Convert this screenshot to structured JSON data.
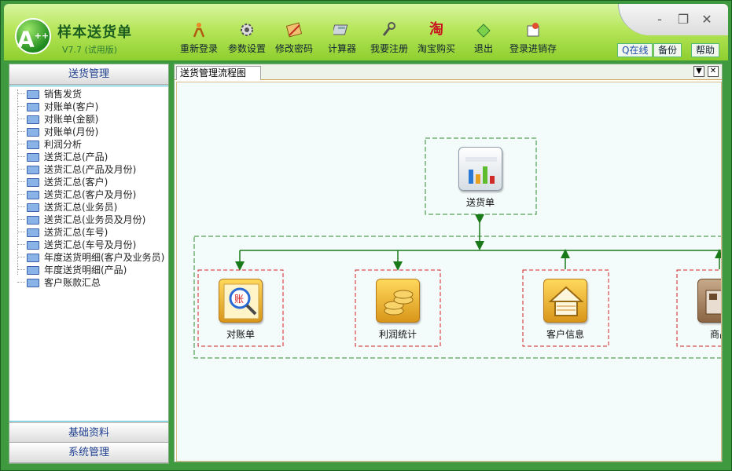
{
  "app": {
    "name": "样本送货单",
    "version": "V7.7 (试用版)",
    "logo_text": "A"
  },
  "window_controls": {
    "minimize": "-",
    "restore": "❐",
    "close": "✕"
  },
  "toolbar": {
    "items": [
      {
        "label": "重新登录",
        "icon": "relogin-icon"
      },
      {
        "label": "参数设置",
        "icon": "settings-gear-icon"
      },
      {
        "label": "修改密码",
        "icon": "password-icon"
      },
      {
        "label": "计算器",
        "icon": "calculator-icon"
      },
      {
        "label": "我要注册",
        "icon": "register-icon"
      },
      {
        "label": "淘宝购买",
        "icon": "taobao-icon"
      },
      {
        "label": "退出",
        "icon": "exit-icon"
      },
      {
        "label": "登录进销存",
        "icon": "inventory-login-icon"
      }
    ],
    "online": "Q在线",
    "backup": "备份",
    "help": "帮助"
  },
  "left_panel": {
    "section_title": "送货管理",
    "tree_items": [
      "销售发货",
      "对账单(客户)",
      "对账单(金额)",
      "对账单(月份)",
      "利润分析",
      "送货汇总(产品)",
      "送货汇总(产品及月份)",
      "送货汇总(客户)",
      "送货汇总(客户及月份)",
      "送货汇总(业务员)",
      "送货汇总(业务员及月份)",
      "送货汇总(车号)",
      "送货汇总(车号及月份)",
      "年度送货明细(客户及业务员)",
      "年度送货明细(产品)",
      "客户账款汇总"
    ],
    "bottom_sections": [
      "基础资料",
      "系统管理"
    ]
  },
  "tab": {
    "title": "送货管理流程图",
    "dropdown": "▼",
    "close": "✕"
  },
  "flowchart": {
    "top_node": {
      "label": "送货单",
      "icon": "delivery-note-chart-icon"
    },
    "nodes": [
      {
        "label": "对账单",
        "icon": "statement-magnifier-icon"
      },
      {
        "label": "利润统计",
        "icon": "coins-stack-icon"
      },
      {
        "label": "客户信息",
        "icon": "house-icon"
      },
      {
        "label": "商品",
        "icon": "goods-icon"
      }
    ],
    "colors": {
      "arrow": "#1a7a1a",
      "group_border": "#2e8b2e",
      "node_border": "#d02020"
    }
  }
}
